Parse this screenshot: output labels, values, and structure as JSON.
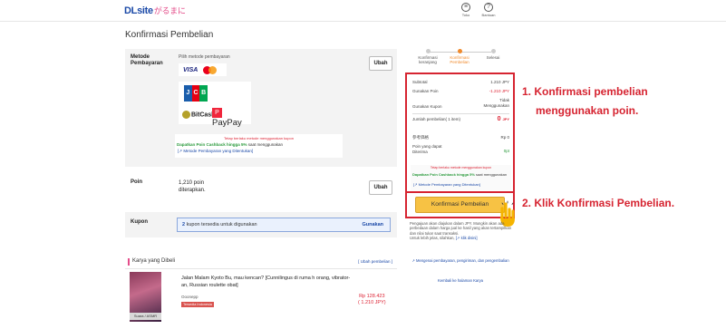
{
  "header": {
    "logo": "DLsite",
    "logo_sub": "がるまに",
    "icons": [
      {
        "name": "stack-icon",
        "label": "Toko"
      },
      {
        "name": "help-icon",
        "label": "Bantuan"
      }
    ]
  },
  "page_title": "Konfirmasi Pembelian",
  "payment": {
    "label": "Metode Pembayaran",
    "hint": "Pilih metode pembayaran",
    "visa": "VISA",
    "jcb": [
      "J",
      "C",
      "B"
    ],
    "bitcash": "BitCash",
    "paypay": "PayPay",
    "cashback_warning": "Tetap berlaku metode menggunakan kupon",
    "cashback_bold": "Dapatkan Poin Cashback hingga 5%",
    "cashback_rest": " saat menggunakan",
    "cashback_link": "Metode Pembayaran yang Ditentukan",
    "change_label": "Ubah"
  },
  "poin": {
    "label": "Poin",
    "value": "1,210 poin",
    "sub": "diterapkan.",
    "change_label": "Ubah"
  },
  "kupon": {
    "label": "Kupon",
    "count": "2",
    "text": "kupon tersedia untuk digunakan",
    "use_label": "Gunakan"
  },
  "items": {
    "heading": "Karya yang Dibeli",
    "change_link": "[ Ubah pembelian ]",
    "list": [
      {
        "title": "Jalan Malam Kyoto Bu, mau kencan? [Cunnilingus di ruma h orang, vibrator-an, Russian roulette obat]",
        "maker": "Ooonepp",
        "badge": "Tersedia Indonesia",
        "thumb_tag": "Suara / ASMR",
        "price": "Rp 128.423",
        "price_jpy": "( 1.210 JPY)"
      }
    ]
  },
  "steps": [
    {
      "label": "Konfirmasi keranjang",
      "active": false
    },
    {
      "label": "Konfirmasi Pembelian",
      "active": true
    },
    {
      "label": "Selesai",
      "active": false
    }
  ],
  "summary": {
    "subtotal_label": "Subtotal",
    "subtotal_value": "1.210 JPY",
    "poin_label": "Gunakan Poin",
    "poin_value": "-1.210 JPY",
    "kupon_label": "Gunakan Kupon",
    "kupon_value_1": "Tidak",
    "kupon_value_2": "Menggunakan",
    "total_label": "Jumlah pembelian( 1 item)",
    "total_value": "0",
    "total_unit": "JPY",
    "ref_label": "参考価格",
    "ref_value": "Rp 0",
    "earn_label": "Poin yang dapat Diterima",
    "earn_value": "0pt",
    "cb_warning": "Tetap berlaku metode menggunakan kupon",
    "cb_bold": "Dapatkan Poin Cashback hingga 5%",
    "cb_rest": " saat menggunakan",
    "cb_link": "Metode Pembayaran yang Ditentukan"
  },
  "confirm_button": "Konfirmasi Pembelian",
  "notes": {
    "text": "Pengajuan akan diajukan dalam JPY. Mungkin akan ada perbedaan dalam harga jual ke hasil yang akan tertampilkan dan nilai tukar saat transaksi.",
    "more_prefix": "Untuk lebih jelas, silahkan, ",
    "more_link": "klik disini",
    "links": "Mengenai pembayaran, pengiriman, dan pengembalian",
    "back": "Kembali ke halaman Karya"
  },
  "annotations": {
    "a1_line1": "1. Konfirmasi pembelian",
    "a1_line2": "menggunakan poin.",
    "a2": "2. Klik Konfirmasi Pembelian."
  },
  "colors": {
    "accent_red": "#d62431",
    "button_yellow": "#f7c244",
    "link_blue": "#1c4aa8",
    "step_active": "#f08a2c"
  }
}
